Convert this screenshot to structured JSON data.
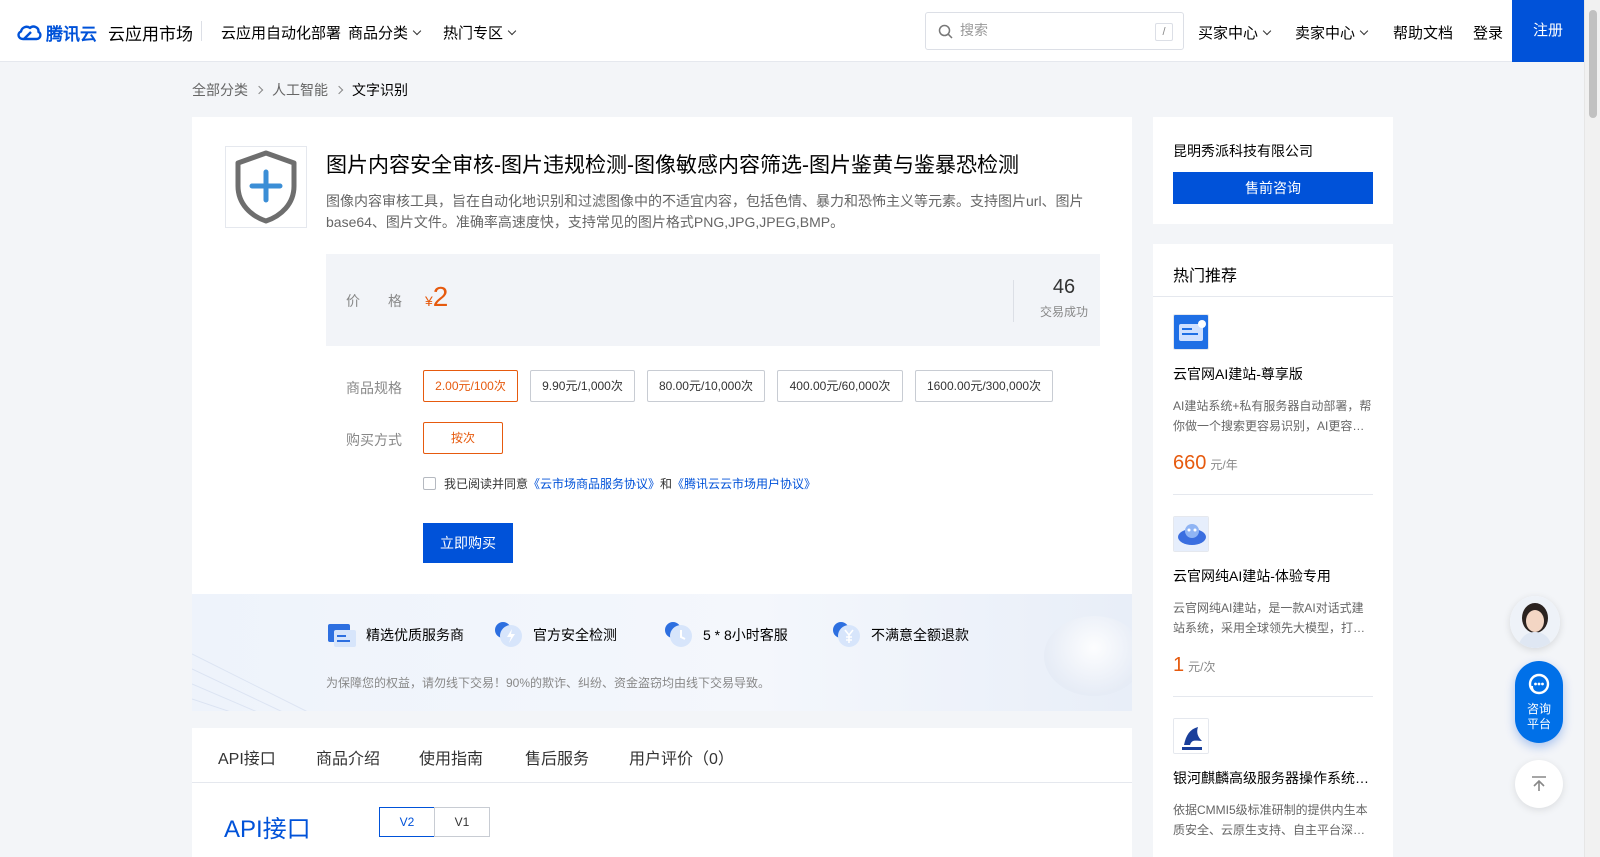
{
  "nav": {
    "logo_text": "腾讯云",
    "market": "云应用市场",
    "links": [
      "云应用自动化部署",
      "商品分类",
      "热门专区"
    ],
    "search_placeholder": "搜索",
    "search_shortcut": "/",
    "right": [
      "买家中心",
      "卖家中心",
      "帮助文档",
      "登录"
    ],
    "register": "注册"
  },
  "breadcrumb": [
    "全部分类",
    "人工智能",
    "文字识别"
  ],
  "product": {
    "title": "图片内容安全审核-图片违规检测-图像敏感内容筛选-图片鉴黄与鉴暴恐检测",
    "description": "图像内容审核工具，旨在自动化地识别和过滤图像中的不适宜内容，包括色情、暴力和恐怖主义等元素。支持图片url、图片base64、图片文件。准确率高速度快，支持常见的图片格式PNG,JPG,JPEG,BMP。",
    "price_label": "价格",
    "currency": "¥",
    "price": "2",
    "deals_count": "46",
    "deals_label": "交易成功",
    "spec_label": "商品规格",
    "specs": [
      "2.00元/100次",
      "9.90元/1,000次",
      "80.00元/10,000次",
      "400.00元/60,000次",
      "1600.00元/300,000次"
    ],
    "selected_spec": "2.00元/100次",
    "buy_mode_label": "购买方式",
    "buy_mode": "按次",
    "agree_prefix": "我已阅读并同意",
    "agree_link1": "《云市场商品服务协议》",
    "agree_and": "和",
    "agree_link2": "《腾讯云云市场用户协议》",
    "buy_button": "立即购买"
  },
  "guarantees": {
    "features": [
      "精选优质服务商",
      "官方安全检测",
      "5 * 8小时客服",
      "不满意全额退款"
    ],
    "note": "为保障您的权益，请勿线下交易！90%的欺诈、纠纷、资金盗窃均由线下交易导致。"
  },
  "tabs": [
    "API接口",
    "商品介绍",
    "使用指南",
    "售后服务",
    "用户评价（0）"
  ],
  "api": {
    "title": "API接口",
    "versions": [
      "V2",
      "V1"
    ],
    "selected": "V2"
  },
  "vendor": {
    "name": "昆明秀派科技有限公司",
    "consult_button": "售前咨询"
  },
  "hot": {
    "title": "热门推荐",
    "items": [
      {
        "name": "云官网AI建站-尊享版",
        "desc": "AI建站系统+私有服务器自动部署，帮你做一个搜索更容易识别，AI更容…",
        "price": "660",
        "unit": "元/年"
      },
      {
        "name": "云官网纯AI建站-体验专用",
        "desc": "云官网纯AI建站，是一款AI对话式建站系统，采用全球领先大模型，打…",
        "price": "1",
        "unit": "元/次"
      },
      {
        "name": "银河麒麟高级服务器操作系统…",
        "desc": "依据CMMI5级标准研制的提供内生本质安全、云原生支持、自主平台深…",
        "price": "",
        "unit": ""
      }
    ]
  },
  "float": {
    "consult": "咨询\n平台"
  },
  "colors": {
    "brand": "#0052d9",
    "price": "#e65a0e"
  }
}
